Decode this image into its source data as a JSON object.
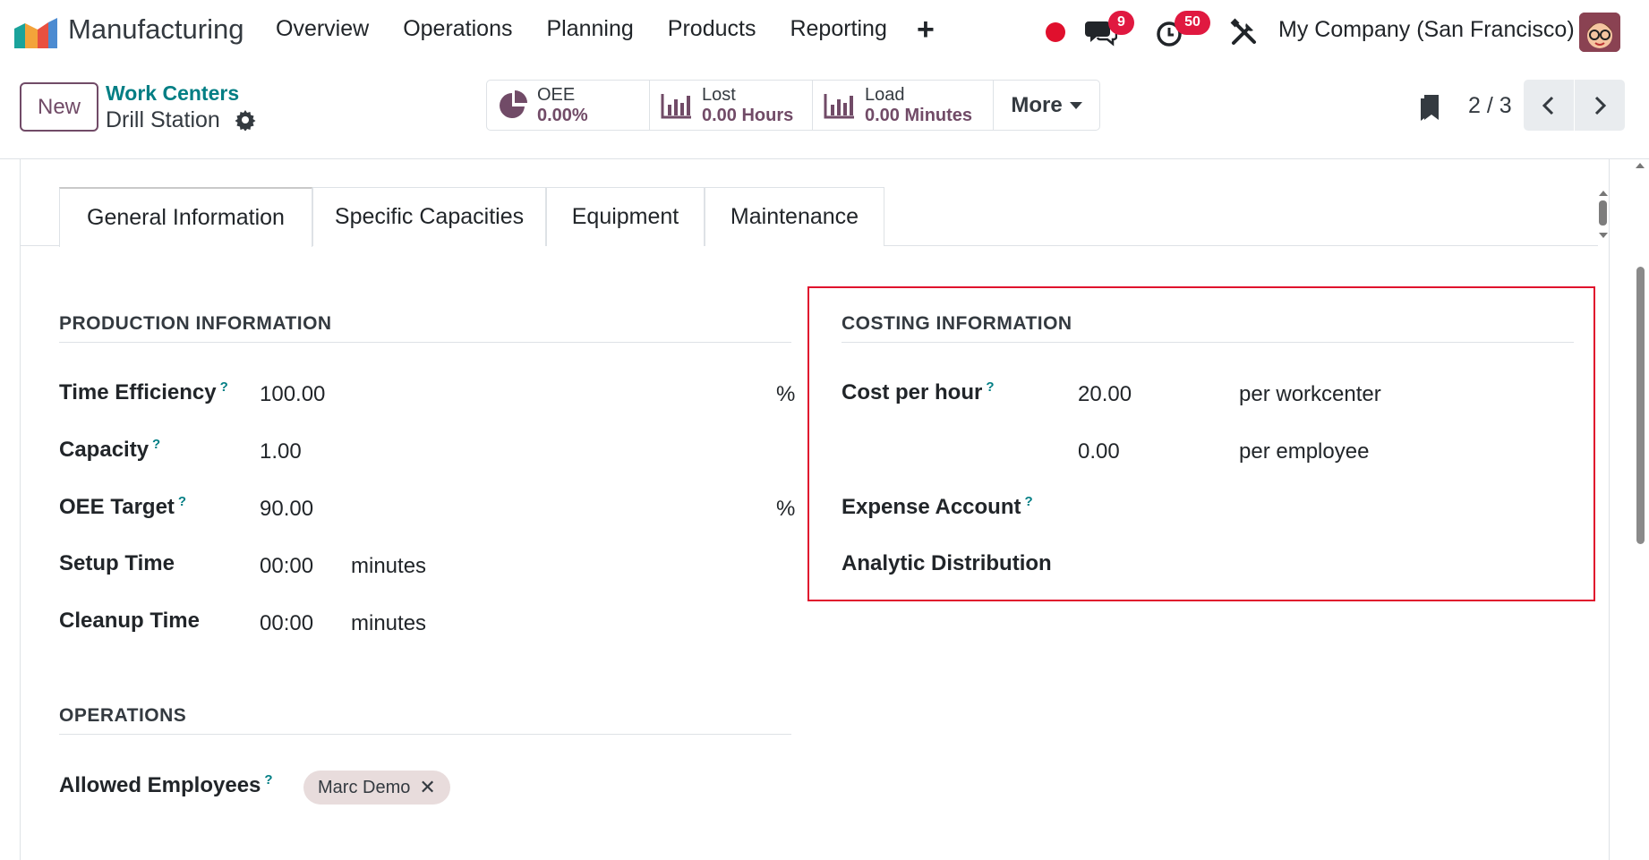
{
  "navbar": {
    "app_name": "Manufacturing",
    "menu": [
      "Overview",
      "Operations",
      "Planning",
      "Products",
      "Reporting"
    ],
    "messages_count": "9",
    "activities_count": "50",
    "company": "My Company (San Francisco)",
    "icons": [
      "manufacturing-logo-icon",
      "plus-icon",
      "record-dot-icon",
      "chat-icon",
      "clock-icon",
      "tools-icon"
    ]
  },
  "control": {
    "new_label": "New",
    "breadcrumb_parent": "Work Centers",
    "breadcrumb_current": "Drill Station",
    "stats": {
      "oee_label": "OEE",
      "oee_value": "0.00%",
      "lost_label": "Lost",
      "lost_value": "0.00 Hours",
      "load_label": "Load",
      "load_value": "0.00 Minutes",
      "more_label": "More"
    },
    "pager": "2 / 3"
  },
  "tabs": [
    "General Information",
    "Specific Capacities",
    "Equipment",
    "Maintenance"
  ],
  "production": {
    "title": "PRODUCTION INFORMATION",
    "time_efficiency_label": "Time Efficiency",
    "time_efficiency_value": "100.00",
    "time_efficiency_unit": "%",
    "capacity_label": "Capacity",
    "capacity_value": "1.00",
    "oee_target_label": "OEE Target",
    "oee_target_value": "90.00",
    "oee_target_unit": "%",
    "setup_time_label": "Setup Time",
    "setup_time_value": "00:00",
    "setup_time_unit": "minutes",
    "cleanup_time_label": "Cleanup Time",
    "cleanup_time_value": "00:00",
    "cleanup_time_unit": "minutes"
  },
  "costing": {
    "title": "COSTING INFORMATION",
    "cost_per_hour_label": "Cost per hour",
    "cost_workcenter_value": "20.00",
    "cost_workcenter_unit": "per workcenter",
    "cost_employee_value": "0.00",
    "cost_employee_unit": "per employee",
    "expense_account_label": "Expense Account",
    "analytic_distribution_label": "Analytic Distribution"
  },
  "operations": {
    "title": "OPERATIONS",
    "allowed_employees_label": "Allowed Employees",
    "employee_tag": "Marc Demo"
  },
  "help_marker": "?",
  "colors": {
    "brand": "#714b67",
    "link": "#017e84",
    "highlight": "#e0102d",
    "badge": "#e01940"
  }
}
